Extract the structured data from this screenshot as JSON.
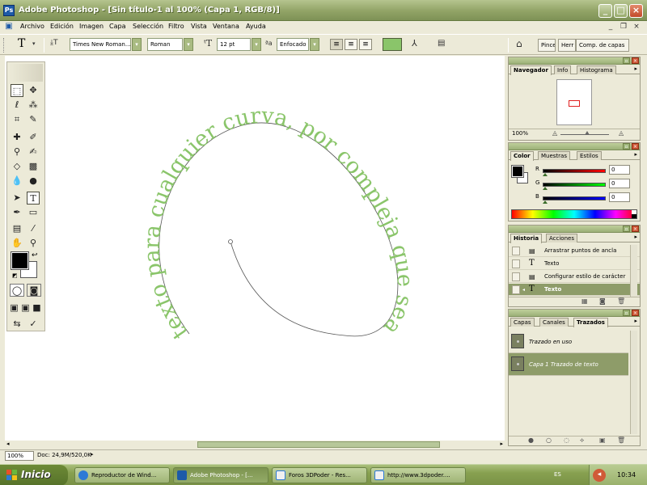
{
  "window": {
    "title": "Adobe Photoshop - [Sin título-1 al 100% (Capa 1, RGB/8)]",
    "app_icon": "Ps"
  },
  "menu": [
    "Archivo",
    "Edición",
    "Imagen",
    "Capa",
    "Selección",
    "Filtro",
    "Vista",
    "Ventana",
    "Ayuda"
  ],
  "options": {
    "font_family": "Times New Roman...",
    "font_style": "Roman",
    "font_size": "12 pt",
    "antialias": "Enfocado",
    "text_color": "#8ac56a",
    "wells": [
      "Pince",
      "Herr",
      "Comp. de capas"
    ]
  },
  "canvas": {
    "text": "texto para cualquier curva, por compleja que sea",
    "text_color": "#8ac56a"
  },
  "status": {
    "zoom": "100%",
    "doc": "Doc: 24,9M/520,0K"
  },
  "navigator": {
    "tabs": [
      "Navegador",
      "Info",
      "Histograma"
    ],
    "zoom": "100%"
  },
  "color_panel": {
    "tabs": [
      "Color",
      "Muestras",
      "Estilos"
    ],
    "channels": [
      {
        "label": "R",
        "value": "0"
      },
      {
        "label": "G",
        "value": "0"
      },
      {
        "label": "B",
        "value": "0"
      }
    ]
  },
  "history": {
    "tabs": [
      "Historia",
      "Acciones"
    ],
    "items": [
      {
        "icon": "anchor-icon",
        "label": "Arrastrar puntos de ancla"
      },
      {
        "icon": "text-icon",
        "label": "Texto"
      },
      {
        "icon": "char-style-icon",
        "label": "Configurar estilo de carácter"
      },
      {
        "icon": "text-icon",
        "label": "Texto"
      }
    ]
  },
  "layers": {
    "tabs": [
      "Capas",
      "Canales",
      "Trazados"
    ],
    "paths": [
      "Trazado en uso",
      "Capa 1 Trazado de texto"
    ]
  },
  "taskbar": {
    "start": "Inicio",
    "tasks": [
      "Reproductor de Wind...",
      "Adobe Photoshop - [...",
      "Foros 3DPoder - Res...",
      "http://www.3dpoder...."
    ],
    "lang": "ES",
    "clock": "10:34"
  }
}
